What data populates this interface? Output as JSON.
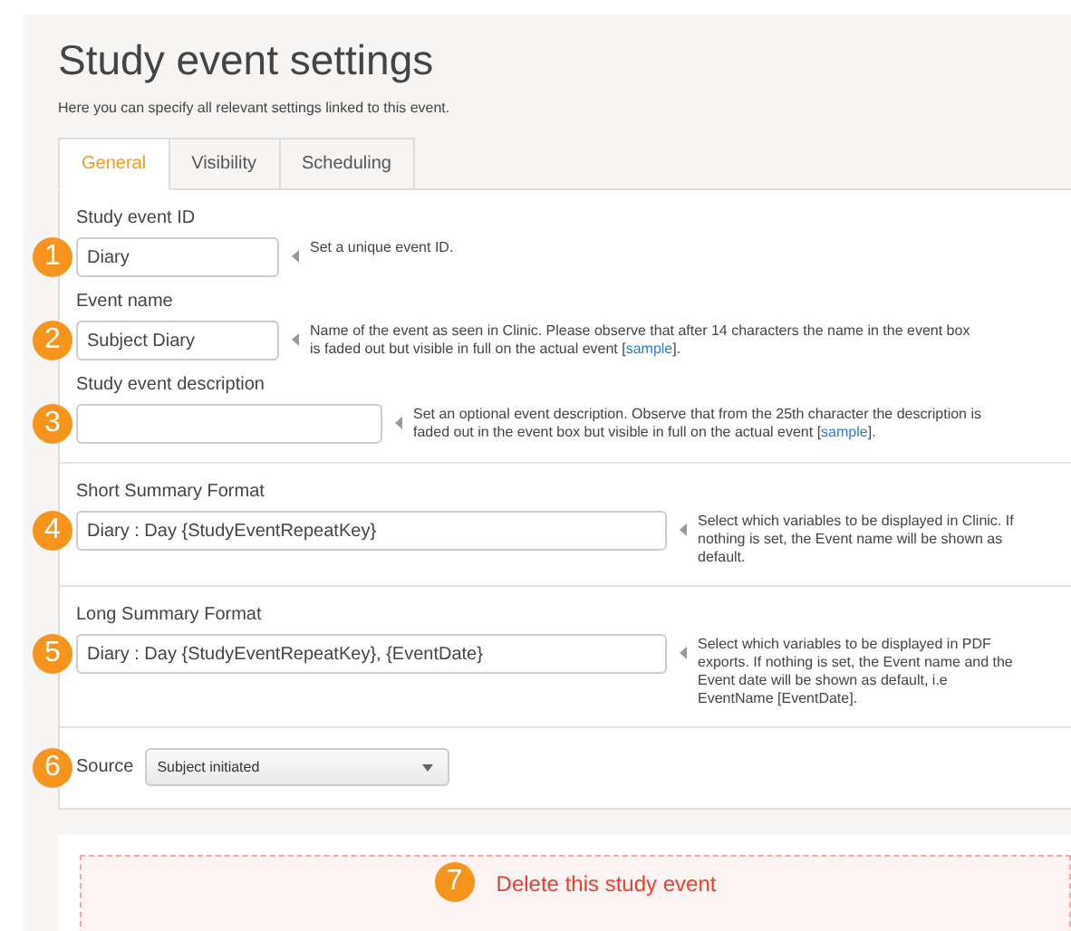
{
  "title": "Study event settings",
  "subtitle": "Here you can specify all relevant settings linked to this event.",
  "tabs": [
    {
      "label": "General",
      "selected": true
    },
    {
      "label": "Visibility",
      "selected": false
    },
    {
      "label": "Scheduling",
      "selected": false
    }
  ],
  "sections": [
    {
      "fields": [
        {
          "badge": "1",
          "label": "Study event ID",
          "value": "Diary",
          "hint": "Set a unique event ID."
        },
        {
          "badge": "2",
          "label": "Event name",
          "value": "Subject Diary",
          "hint": "Name of the event as seen in Clinic. Please observe that after 14 characters the name in the event box is faded out but visible in full on the actual event [",
          "link": "sample",
          "hint_end": "]."
        },
        {
          "badge": "3",
          "label": "Study event description",
          "hint": "Set an optional event description. Observe that from the 25th character the description is faded out in the event box but visible in full on the actual event [",
          "link": "sample",
          "hint_end": "]."
        }
      ]
    },
    {
      "fields": [
        {
          "badge": "4",
          "label": "Short Summary Format",
          "value": "Diary : Day {StudyEventRepeatKey}",
          "hint": "Select which variables to be displayed in Clinic. If nothing is set, the Event name will be shown as default."
        }
      ]
    },
    {
      "fields": [
        {
          "badge": "5",
          "label": "Long Summary Format",
          "value": "Diary : Day {StudyEventRepeatKey}, {EventDate}",
          "hint": "Select which variables to be displayed in PDF exports. If nothing is set, the Event name and the Event date will be shown as default, i.e EventName [EventDate]."
        }
      ]
    }
  ],
  "source": {
    "badge": "6",
    "label": "Source",
    "value": "Subject initiated"
  },
  "delete": {
    "badge": "7",
    "label": "Delete this study event"
  }
}
